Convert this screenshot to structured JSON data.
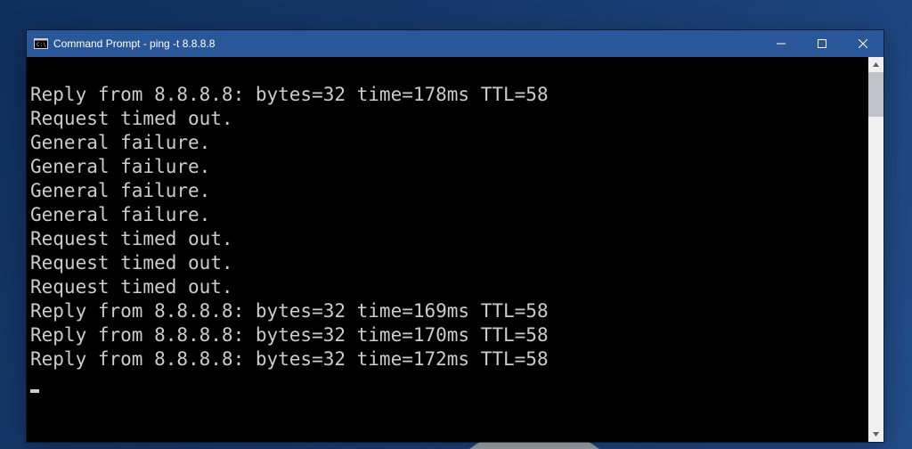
{
  "window": {
    "title": "Command Prompt - ping  -t 8.8.8.8"
  },
  "console": {
    "lines": [
      "Reply from 8.8.8.8: bytes=32 time=178ms TTL=58",
      "Request timed out.",
      "General failure.",
      "General failure.",
      "General failure.",
      "General failure.",
      "Request timed out.",
      "Request timed out.",
      "Request timed out.",
      "Reply from 8.8.8.8: bytes=32 time=169ms TTL=58",
      "Reply from 8.8.8.8: bytes=32 time=170ms TTL=58",
      "Reply from 8.8.8.8: bytes=32 time=172ms TTL=58"
    ]
  }
}
